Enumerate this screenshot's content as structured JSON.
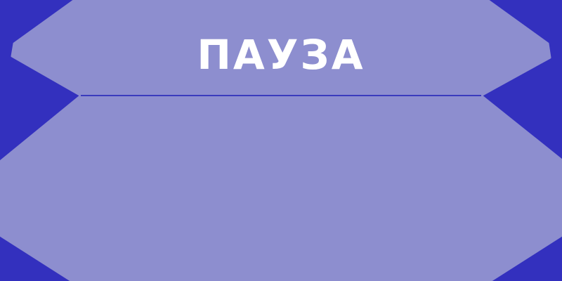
{
  "screen": {
    "title": "ПАУЗА"
  },
  "colors": {
    "background": "#3330be",
    "panel": "#8d8ecf",
    "divider": "#3a3bbd",
    "title_text": "#ffffff"
  }
}
